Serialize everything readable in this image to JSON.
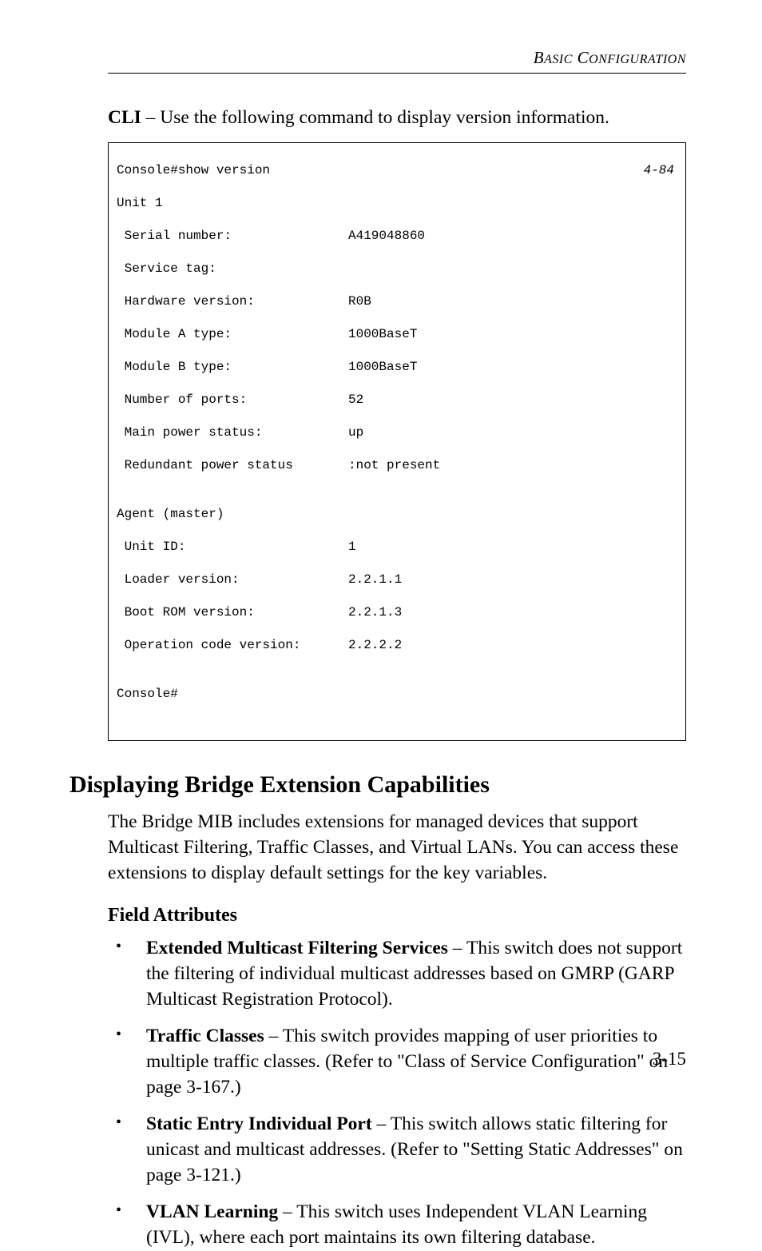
{
  "running_head": "BASIC CONFIGURATION",
  "intro_prefix": "CLI",
  "intro_text": " – Use the following command to display version information.",
  "cli": {
    "ref": "4-84",
    "line1": "Console#show version",
    "line2": "Unit 1",
    "rows": [
      {
        "label": " Serial number:",
        "value": "A419048860"
      },
      {
        "label": " Service tag:",
        "value": ""
      },
      {
        "label": " Hardware version:",
        "value": "R0B"
      },
      {
        "label": " Module A type:",
        "value": "1000BaseT"
      },
      {
        "label": " Module B type:",
        "value": "1000BaseT"
      },
      {
        "label": " Number of ports:",
        "value": "52"
      },
      {
        "label": " Main power status:",
        "value": "up"
      },
      {
        "label": " Redundant power status",
        "value": ":not present"
      }
    ],
    "blank": "",
    "agent_header": "Agent (master)",
    "agent_rows": [
      {
        "label": " Unit ID:",
        "value": "1"
      },
      {
        "label": " Loader version:",
        "value": "2.2.1.1"
      },
      {
        "label": " Boot ROM version:",
        "value": "2.2.1.3"
      },
      {
        "label": " Operation code version:",
        "value": "2.2.2.2"
      }
    ],
    "blank2": "",
    "prompt": "Console#"
  },
  "h2": "Displaying Bridge Extension Capabilities",
  "section_body": "The Bridge MIB includes extensions for managed devices that support Multicast Filtering, Traffic Classes, and Virtual LANs. You can access these extensions to display default settings for the key variables.",
  "h3": "Field Attributes",
  "bullets": [
    {
      "term": "Extended Multicast Filtering Services",
      "rest": " – This switch does not support the filtering of individual multicast addresses based on GMRP (GARP Multicast Registration Protocol)."
    },
    {
      "term": "Traffic Classes",
      "rest": " – This switch provides mapping of user priorities to multiple traffic classes. (Refer to \"Class of Service Configuration\" on page 3-167.)"
    },
    {
      "term": "Static Entry Individual Port",
      "rest": " – This switch allows static filtering for unicast and multicast addresses. (Refer to \"Setting Static Addresses\" on page 3-121.)"
    },
    {
      "term": "VLAN Learning",
      "rest": " – This switch uses Independent VLAN Learning (IVL), where each port maintains its own filtering database."
    }
  ],
  "page_number": "3-15"
}
